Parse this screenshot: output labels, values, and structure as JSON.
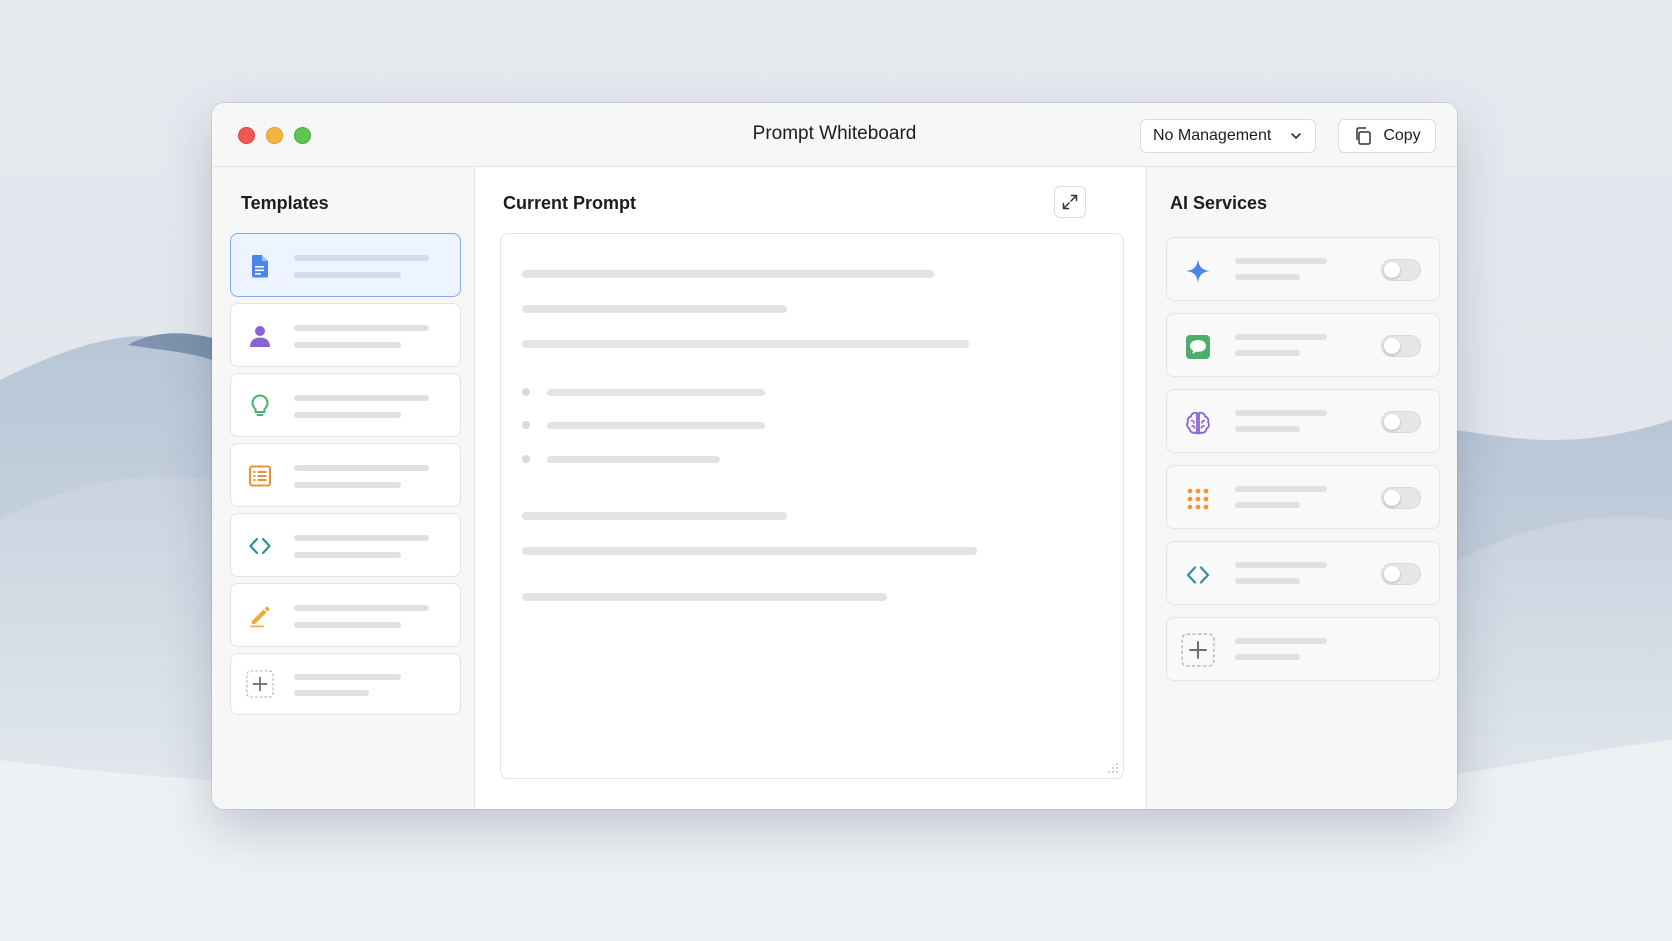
{
  "window": {
    "title": "Prompt Whiteboard",
    "management_dropdown": {
      "selected": "No Management"
    },
    "copy_label": "Copy"
  },
  "templates": {
    "title": "Templates",
    "items": [
      {
        "icon": "document-icon",
        "color": "#4a86e8",
        "selected": true
      },
      {
        "icon": "person-icon",
        "color": "#8a63d2",
        "selected": false
      },
      {
        "icon": "lightbulb-icon",
        "color": "#4cae6b",
        "selected": false
      },
      {
        "icon": "list-icon",
        "color": "#f0922b",
        "selected": false
      },
      {
        "icon": "code-icon",
        "color": "#2f8f9d",
        "selected": false
      },
      {
        "icon": "pencil-icon",
        "color": "#f2a93b",
        "selected": false
      },
      {
        "icon": "add-icon",
        "color": "#6b6b70",
        "selected": false
      }
    ]
  },
  "current_prompt": {
    "title": "Current Prompt"
  },
  "ai_services": {
    "title": "AI Services",
    "items": [
      {
        "icon": "sparkle-icon",
        "color": "#4a86e8",
        "enabled": false
      },
      {
        "icon": "chat-bubble-icon",
        "color": "#4cae6b",
        "enabled": false
      },
      {
        "icon": "brain-icon",
        "color": "#8a63d2",
        "enabled": false
      },
      {
        "icon": "dot-grid-icon",
        "color": "#f0922b",
        "enabled": false
      },
      {
        "icon": "code-icon",
        "color": "#2f8f9d",
        "enabled": false
      },
      {
        "icon": "add-icon",
        "color": "#6b6b70"
      }
    ]
  }
}
